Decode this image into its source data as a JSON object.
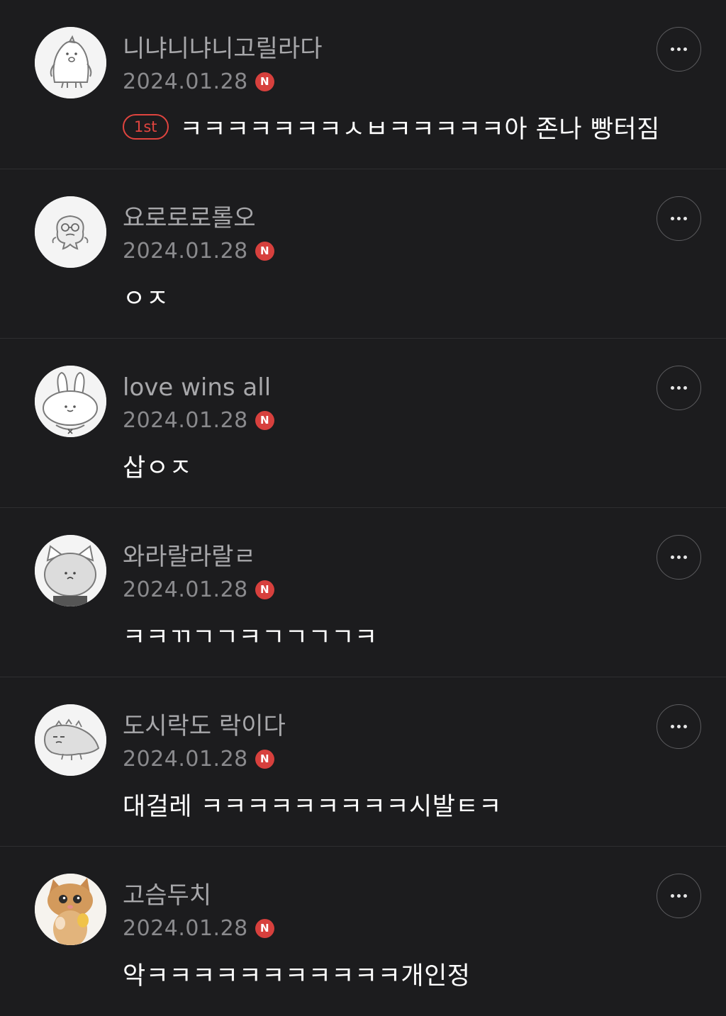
{
  "comments": [
    {
      "nickname": "니냐니냐니고릴라다",
      "date": "2024.01.28",
      "new_badge": "N",
      "rank_badge": "1st",
      "text": "ㅋㅋㅋㅋㅋㅋㅋㅅㅂㅋㅋㅋㅋㅋ아 존나 빵터짐",
      "avatar": "penguin-character"
    },
    {
      "nickname": "요로로로롤오",
      "date": "2024.01.28",
      "new_badge": "N",
      "text": "ㅇㅈ",
      "avatar": "blob-with-glasses-character"
    },
    {
      "nickname": "love wins all",
      "date": "2024.01.28",
      "new_badge": "N",
      "text": "삽ㅇㅈ",
      "avatar": "bunny-character"
    },
    {
      "nickname": "와라랄라랄ㄹ",
      "date": "2024.01.28",
      "new_badge": "N",
      "text": "ㅋㅋㄲㄱㄱㅋㄱㄱㄱㄱㅋ",
      "avatar": "cat-character"
    },
    {
      "nickname": "도시락도 락이다",
      "date": "2024.01.28",
      "new_badge": "N",
      "text": "대걸레 ㅋㅋㅋㅋㅋㅋㅋㅋㅋ시발ㅌㅋ",
      "avatar": "lizard-character"
    },
    {
      "nickname": "고슴두치",
      "date": "2024.01.28",
      "new_badge": "N",
      "text": "악ㅋㅋㅋㅋㅋㅋㅋㅋㅋㅋㅋ개인정",
      "avatar": "kitten-photo"
    }
  ],
  "colors": {
    "background": "#1c1c1e",
    "nickname": "#a7a7aa",
    "date": "#8a8a8d",
    "new_badge": "#d7403d",
    "rank_badge": "#e0443f",
    "divider": "#2e2e30"
  }
}
